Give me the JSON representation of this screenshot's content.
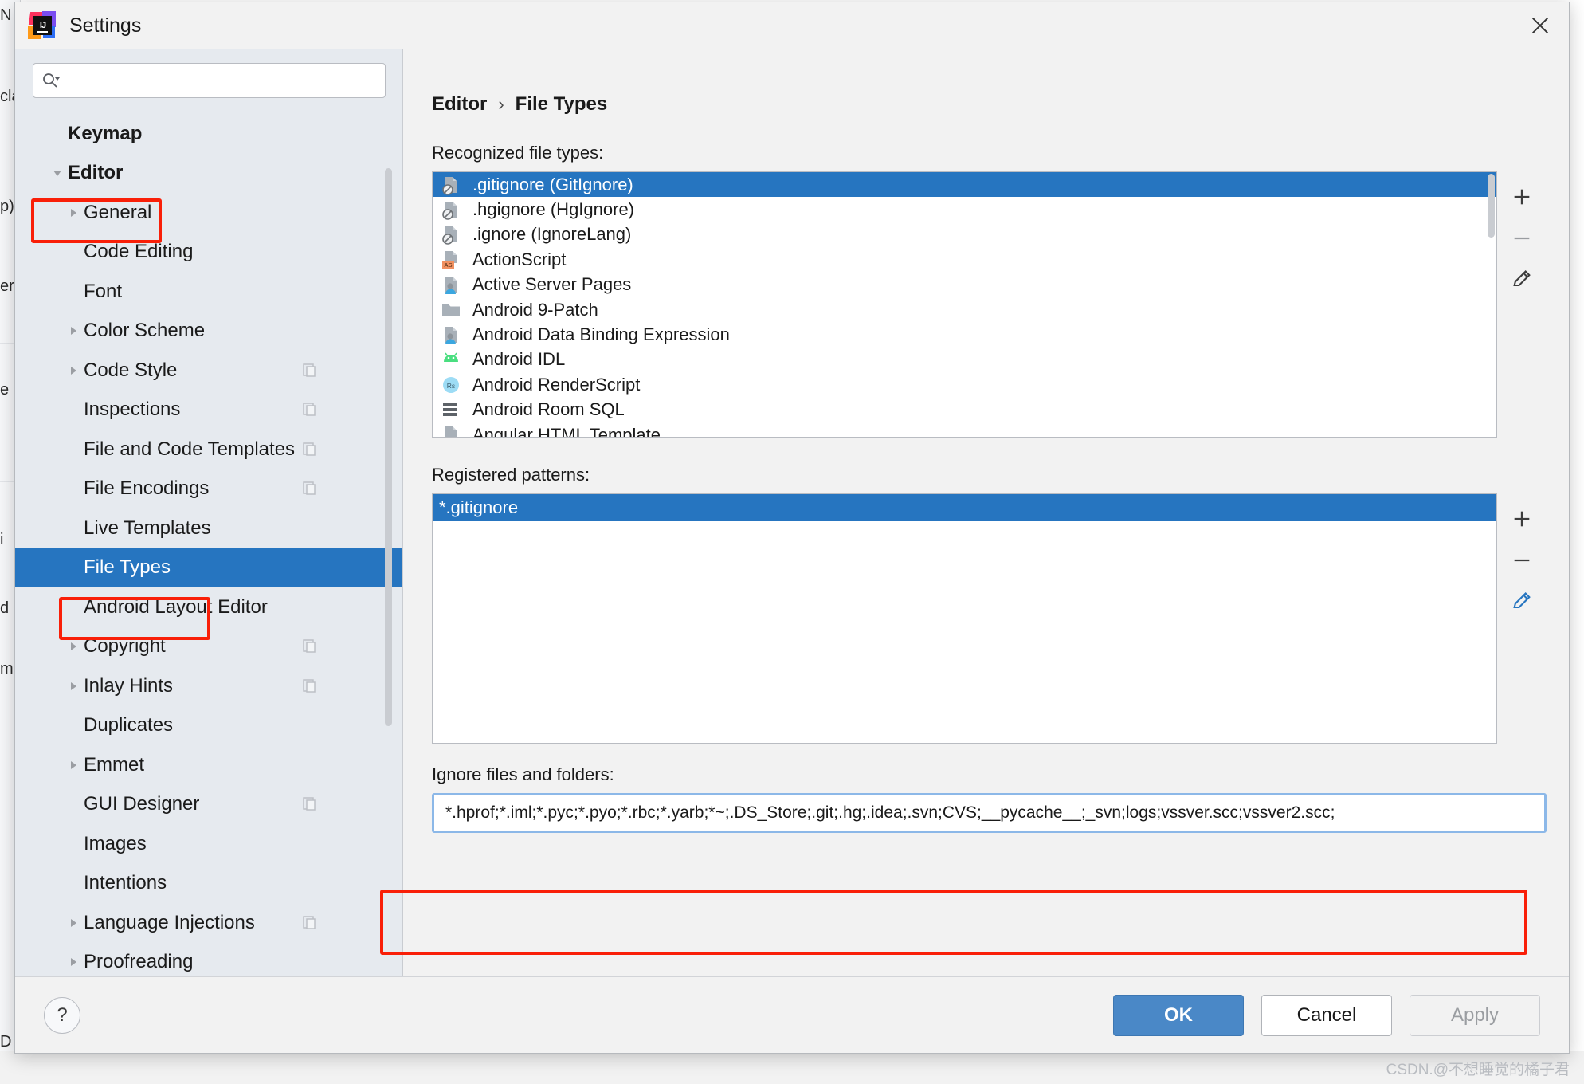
{
  "window": {
    "title": "Settings",
    "logo_text": "IJ",
    "close_label": "×"
  },
  "search": {
    "value": "",
    "placeholder": ""
  },
  "sidebar": {
    "scroll_present": true,
    "items": [
      {
        "label": "Keymap",
        "level": 0,
        "arrow": "none",
        "bold": true,
        "selected": false,
        "copy": false
      },
      {
        "label": "Editor",
        "level": 0,
        "arrow": "expanded",
        "bold": true,
        "selected": false,
        "copy": false
      },
      {
        "label": "General",
        "level": 1,
        "arrow": "collapsed",
        "bold": false,
        "selected": false,
        "copy": false
      },
      {
        "label": "Code Editing",
        "level": 1,
        "arrow": "none",
        "bold": false,
        "selected": false,
        "copy": false
      },
      {
        "label": "Font",
        "level": 1,
        "arrow": "none",
        "bold": false,
        "selected": false,
        "copy": false
      },
      {
        "label": "Color Scheme",
        "level": 1,
        "arrow": "collapsed",
        "bold": false,
        "selected": false,
        "copy": false
      },
      {
        "label": "Code Style",
        "level": 1,
        "arrow": "collapsed",
        "bold": false,
        "selected": false,
        "copy": true
      },
      {
        "label": "Inspections",
        "level": 1,
        "arrow": "none",
        "bold": false,
        "selected": false,
        "copy": true
      },
      {
        "label": "File and Code Templates",
        "level": 1,
        "arrow": "none",
        "bold": false,
        "selected": false,
        "copy": true
      },
      {
        "label": "File Encodings",
        "level": 1,
        "arrow": "none",
        "bold": false,
        "selected": false,
        "copy": true
      },
      {
        "label": "Live Templates",
        "level": 1,
        "arrow": "none",
        "bold": false,
        "selected": false,
        "copy": false
      },
      {
        "label": "File Types",
        "level": 1,
        "arrow": "none",
        "bold": false,
        "selected": true,
        "copy": false
      },
      {
        "label": "Android Layout Editor",
        "level": 1,
        "arrow": "none",
        "bold": false,
        "selected": false,
        "copy": false
      },
      {
        "label": "Copyright",
        "level": 1,
        "arrow": "collapsed",
        "bold": false,
        "selected": false,
        "copy": true
      },
      {
        "label": "Inlay Hints",
        "level": 1,
        "arrow": "collapsed",
        "bold": false,
        "selected": false,
        "copy": true
      },
      {
        "label": "Duplicates",
        "level": 1,
        "arrow": "none",
        "bold": false,
        "selected": false,
        "copy": false
      },
      {
        "label": "Emmet",
        "level": 1,
        "arrow": "collapsed",
        "bold": false,
        "selected": false,
        "copy": false
      },
      {
        "label": "GUI Designer",
        "level": 1,
        "arrow": "none",
        "bold": false,
        "selected": false,
        "copy": true
      },
      {
        "label": "Images",
        "level": 1,
        "arrow": "none",
        "bold": false,
        "selected": false,
        "copy": false
      },
      {
        "label": "Intentions",
        "level": 1,
        "arrow": "none",
        "bold": false,
        "selected": false,
        "copy": false
      },
      {
        "label": "Language Injections",
        "level": 1,
        "arrow": "collapsed",
        "bold": false,
        "selected": false,
        "copy": true
      },
      {
        "label": "Proofreading",
        "level": 1,
        "arrow": "collapsed",
        "bold": false,
        "selected": false,
        "copy": false
      }
    ]
  },
  "breadcrumb": {
    "root": "Editor",
    "separator": "›",
    "current": "File Types"
  },
  "main": {
    "recognized_label": "Recognized file types:",
    "registered_label": "Registered patterns:",
    "ignore_label": "Ignore files and folders:",
    "ignore_value": "*.hprof;*.iml;*.pyc;*.pyo;*.rbc;*.yarb;*~;.DS_Store;.git;.hg;.idea;.svn;CVS;__pycache__;_svn;logs;vssver.scc;vssver2.scc;",
    "file_types": [
      {
        "name": ".gitignore (GitIgnore)",
        "icon": "file-ignore-icon",
        "selected": true
      },
      {
        "name": ".hgignore (HgIgnore)",
        "icon": "file-ignore-icon",
        "selected": false
      },
      {
        "name": ".ignore (IgnoreLang)",
        "icon": "file-ignore-icon",
        "selected": false
      },
      {
        "name": "ActionScript",
        "icon": "actionscript-icon",
        "selected": false
      },
      {
        "name": "Active Server Pages",
        "icon": "file-person-icon",
        "selected": false
      },
      {
        "name": "Android 9-Patch",
        "icon": "folder-icon",
        "selected": false
      },
      {
        "name": "Android Data Binding Expression",
        "icon": "file-person-icon",
        "selected": false
      },
      {
        "name": "Android IDL",
        "icon": "android-icon",
        "selected": false
      },
      {
        "name": "Android RenderScript",
        "icon": "renderscript-icon",
        "selected": false
      },
      {
        "name": "Android Room SQL",
        "icon": "sql-icon",
        "selected": false
      },
      {
        "name": "Angular HTML Template",
        "icon": "angular-html-icon",
        "selected": false
      }
    ],
    "patterns": [
      {
        "name": "*.gitignore",
        "selected": true
      }
    ],
    "list_buttons": [
      {
        "name": "add-button",
        "glyph": "+"
      },
      {
        "name": "remove-button",
        "glyph": "−"
      },
      {
        "name": "edit-button",
        "glyph": "pencil"
      }
    ],
    "pattern_buttons": [
      {
        "name": "add-pattern-button",
        "glyph": "+"
      },
      {
        "name": "remove-pattern-button",
        "glyph": "−"
      },
      {
        "name": "edit-pattern-button",
        "glyph": "pencil"
      }
    ]
  },
  "footer": {
    "help_label": "?",
    "ok_label": "OK",
    "cancel_label": "Cancel",
    "apply_label": "Apply"
  },
  "watermark": {
    "text": "CSDN.@不想睡觉的橘子君"
  },
  "background": {
    "fragments": [
      "cla",
      "p)",
      "er",
      "e",
      "i",
      "d",
      "m",
      "N",
      "D"
    ]
  },
  "colors": {
    "accent": "#2675c0",
    "annotation": "#f91f08",
    "ok_button": "#4a88c7",
    "sidebar_bg": "#e6eaef"
  }
}
